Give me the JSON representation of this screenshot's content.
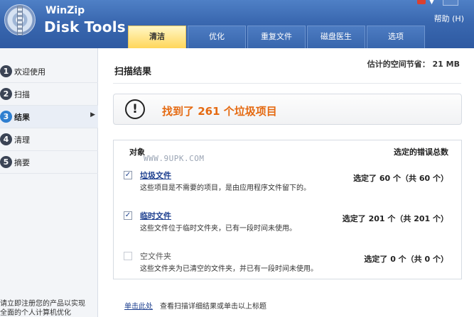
{
  "app": {
    "brand_small": "WinZip",
    "brand_big": "Disk Tools",
    "help": "帮助 (H)",
    "watermark": "WWW.9UPK.COM"
  },
  "tabs": [
    {
      "label": "清洁",
      "active": true
    },
    {
      "label": "优化",
      "active": false
    },
    {
      "label": "重复文件",
      "active": false
    },
    {
      "label": "磁盘医生",
      "active": false
    },
    {
      "label": "选项",
      "active": false
    }
  ],
  "sidebar": {
    "items": [
      {
        "num": "1",
        "label": "欢迎使用"
      },
      {
        "num": "2",
        "label": "扫描"
      },
      {
        "num": "3",
        "label": "结果",
        "active": true
      },
      {
        "num": "4",
        "label": "清理"
      },
      {
        "num": "5",
        "label": "摘要"
      }
    ],
    "footer_line1": "请立即注册您的产品以实现",
    "footer_line2": "全面的个人计算机优化"
  },
  "main": {
    "title": "扫描结果",
    "savings": "估计的空间节省： 21 MB",
    "notice": "找到了 261 个垃圾项目",
    "col_object": "对象",
    "col_total": "选定的错误总数",
    "rows": [
      {
        "checked": "✓",
        "title": "垃圾文件",
        "desc": "这些项目是不需要的项目，是由应用程序文件留下的。",
        "count": "选定了 60 个（共 60 个）"
      },
      {
        "checked": "✓",
        "title": "临时文件",
        "desc": "这些文件位于临时文件夹，已有一段时间未使用。",
        "count": "选定了 201 个（共 201 个）"
      },
      {
        "checked": "",
        "title": "空文件夹",
        "desc": "这些文件夹为已清空的文件夹，并已有一段时间未使用。",
        "count": "选定了 0 个（共 0 个）"
      }
    ],
    "bottom_link": "单击此处",
    "bottom_text": "查看扫描详细结果或单击以上标题"
  },
  "colors": {
    "header_blue": "#3a68b0",
    "active_tab": "#ffd65a",
    "notice_orange": "#e56a12",
    "link_blue": "#1d3f8f"
  }
}
